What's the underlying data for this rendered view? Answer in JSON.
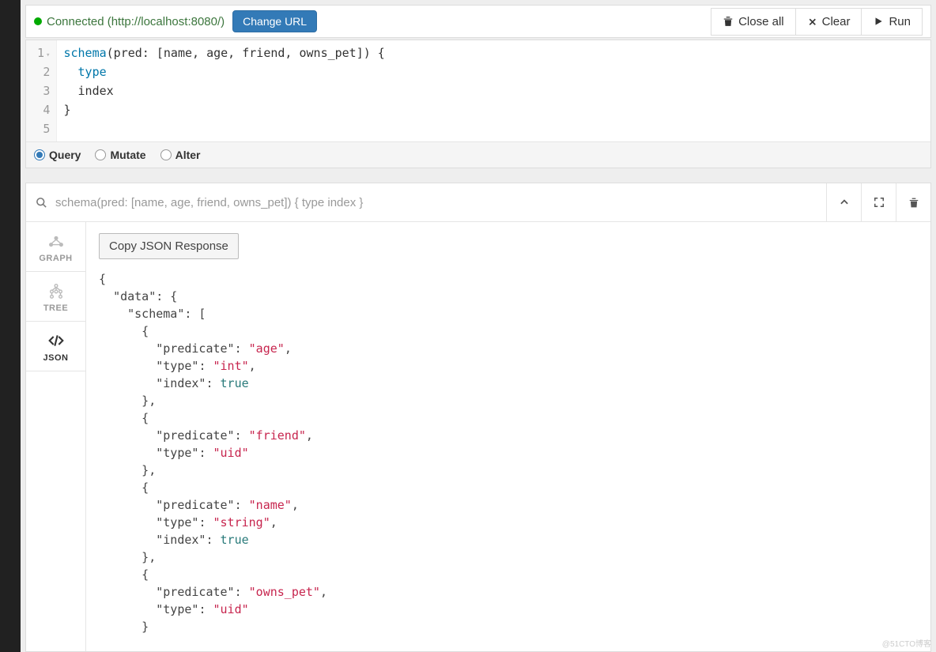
{
  "connection": {
    "status_text": "Connected (http://localhost:8080/)",
    "change_url": "Change URL"
  },
  "toolbar": {
    "close_all": "Close all",
    "clear": "Clear",
    "run": "Run"
  },
  "editor": {
    "lines": [
      {
        "n": "1",
        "tokens": [
          {
            "t": "schema",
            "c": "blue"
          },
          {
            "t": "(pred: [name, age, friend, owns_pet]) {",
            "c": "txt"
          }
        ]
      },
      {
        "n": "2",
        "tokens": [
          {
            "t": "  ",
            "c": "txt"
          },
          {
            "t": "type",
            "c": "blue"
          }
        ]
      },
      {
        "n": "3",
        "tokens": [
          {
            "t": "  index",
            "c": "txt"
          }
        ]
      },
      {
        "n": "4",
        "tokens": [
          {
            "t": "}",
            "c": "txt"
          }
        ]
      },
      {
        "n": "5",
        "tokens": [
          {
            "t": "",
            "c": "txt"
          }
        ]
      }
    ]
  },
  "modes": {
    "query": "Query",
    "mutate": "Mutate",
    "alter": "Alter",
    "selected": "query"
  },
  "result": {
    "echo": "schema(pred: [name, age, friend, owns_pet]) { type index }",
    "copy_btn": "Copy JSON Response",
    "tabs": {
      "graph": "GRAPH",
      "tree": "TREE",
      "json": "JSON",
      "active": "json"
    },
    "json_tokens": [
      {
        "i": 0,
        "t": "{"
      },
      {
        "i": 1,
        "t": "\"data\": {"
      },
      {
        "i": 2,
        "t": "\"schema\": ["
      },
      {
        "i": 3,
        "t": "{"
      },
      {
        "i": 4,
        "kv": [
          [
            "\"predicate\"",
            ": "
          ],
          [
            "\"age\"",
            ","
          ]
        ]
      },
      {
        "i": 4,
        "kv": [
          [
            "\"type\"",
            ": "
          ],
          [
            "\"int\"",
            ","
          ]
        ]
      },
      {
        "i": 4,
        "kb": [
          [
            "\"index\"",
            ": "
          ],
          [
            "true",
            ""
          ]
        ]
      },
      {
        "i": 3,
        "t": "},"
      },
      {
        "i": 3,
        "t": "{"
      },
      {
        "i": 4,
        "kv": [
          [
            "\"predicate\"",
            ": "
          ],
          [
            "\"friend\"",
            ","
          ]
        ]
      },
      {
        "i": 4,
        "kv": [
          [
            "\"type\"",
            ": "
          ],
          [
            "\"uid\"",
            ""
          ]
        ]
      },
      {
        "i": 3,
        "t": "},"
      },
      {
        "i": 3,
        "t": "{"
      },
      {
        "i": 4,
        "kv": [
          [
            "\"predicate\"",
            ": "
          ],
          [
            "\"name\"",
            ","
          ]
        ]
      },
      {
        "i": 4,
        "kv": [
          [
            "\"type\"",
            ": "
          ],
          [
            "\"string\"",
            ","
          ]
        ]
      },
      {
        "i": 4,
        "kb": [
          [
            "\"index\"",
            ": "
          ],
          [
            "true",
            ""
          ]
        ]
      },
      {
        "i": 3,
        "t": "},"
      },
      {
        "i": 3,
        "t": "{"
      },
      {
        "i": 4,
        "kv": [
          [
            "\"predicate\"",
            ": "
          ],
          [
            "\"owns_pet\"",
            ","
          ]
        ]
      },
      {
        "i": 4,
        "kv": [
          [
            "\"type\"",
            ": "
          ],
          [
            "\"uid\"",
            ""
          ]
        ]
      },
      {
        "i": 3,
        "t": "}"
      }
    ]
  },
  "watermark": "@51CTO博客"
}
